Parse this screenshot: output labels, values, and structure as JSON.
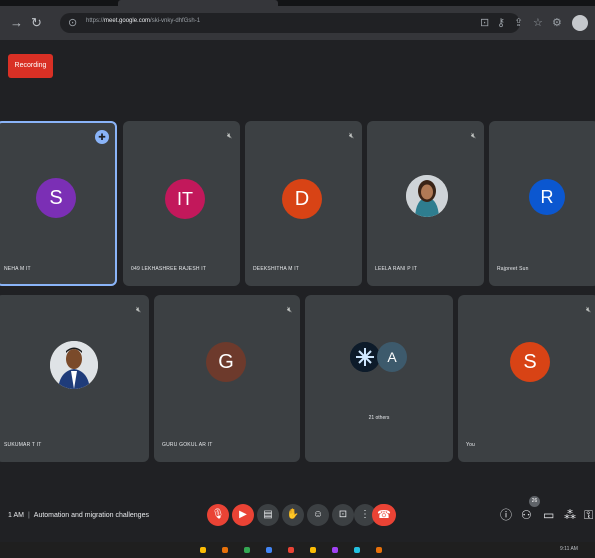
{
  "browser": {
    "url_host": "meet.google.com",
    "url_prefix": "https://",
    "url_path": "/ski-vnky-dhfGsh-1"
  },
  "recording_label": "Recording",
  "participants_row1": [
    {
      "initial": "S",
      "name": "NEHA M IT",
      "color": "#7b2fb5",
      "pinned": true
    },
    {
      "initial": "IT",
      "name": "049 LEKHASHREE RAJESH IT",
      "color": "#c2185b"
    },
    {
      "initial": "D",
      "name": "DEEKSHITHA M IT",
      "color": "#d84315"
    },
    {
      "initial": "",
      "name": "LEELA RANI P IT",
      "photo": true
    },
    {
      "initial": "R",
      "name": "Rajpreet Sun",
      "color": "#0b57d0"
    }
  ],
  "participants_row2": [
    {
      "initial": "",
      "name": "SUKUMAR T IT",
      "photo": true
    },
    {
      "initial": "G",
      "name": "GURU GOKUL AR IT",
      "color": "#6d3a2c"
    },
    {
      "initial": "A",
      "name": "21 others",
      "color": "#3d5a6c",
      "others": true
    },
    {
      "initial": "S",
      "name": "You",
      "color": "#d84315"
    }
  ],
  "meeting": {
    "time": "1 AM",
    "title": "Automation and migration challenges"
  },
  "people_count": "26",
  "clock": "9:11 AM"
}
